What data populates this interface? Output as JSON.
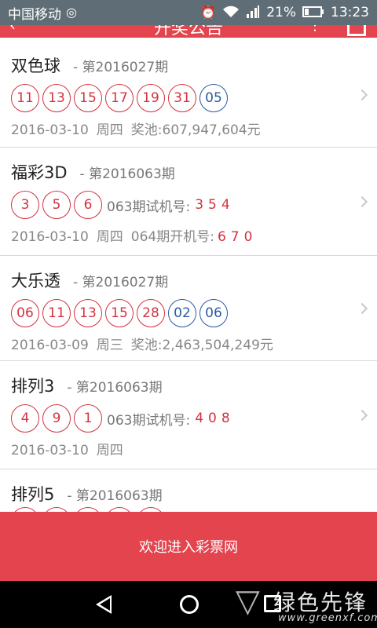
{
  "status_bar": {
    "carrier": "中国移动",
    "battery": "21%",
    "time": "13:23",
    "icons": [
      "hotspot-icon",
      "alarm-icon",
      "wifi-icon",
      "signal-icon",
      "battery-icon"
    ]
  },
  "header": {
    "title": "开奖公告",
    "icons": [
      "back-arrow-icon",
      "more-icon",
      "share-icon"
    ]
  },
  "lotteries": [
    {
      "name": "双色球",
      "issue": "- 第2016027期",
      "red_balls": [
        "11",
        "13",
        "15",
        "17",
        "19",
        "31"
      ],
      "blue_balls": [
        "05"
      ],
      "date": "2016-03-10",
      "weekday": "周四",
      "extra": "奖池:607,947,604元"
    },
    {
      "name": "福彩3D",
      "issue": "- 第2016063期",
      "red_balls": [
        "3",
        "5",
        "6"
      ],
      "trial_label": "063期试机号:",
      "trial_number": "354",
      "date": "2016-03-10",
      "weekday": "周四",
      "extra_label": "064期开机号:",
      "extra_number": "670"
    },
    {
      "name": "大乐透",
      "issue": "- 第2016027期",
      "red_balls": [
        "06",
        "11",
        "13",
        "15",
        "28"
      ],
      "blue_balls": [
        "02",
        "06"
      ],
      "date": "2016-03-09",
      "weekday": "周三",
      "extra": "奖池:2,463,504,249元"
    },
    {
      "name": "排列3",
      "issue": "- 第2016063期",
      "red_balls": [
        "4",
        "9",
        "1"
      ],
      "trial_label": "063期试机号:",
      "trial_number": "408",
      "date": "2016-03-10",
      "weekday": "周四"
    },
    {
      "name": "排列5",
      "issue": "- 第2016063期"
    }
  ],
  "banner": {
    "text": "欢迎进入彩票网"
  },
  "watermark": {
    "text": "绿色先锋",
    "url": "www.greenxf.com"
  },
  "colors": {
    "accent": "#e3444d",
    "red_ball": "#d3323e",
    "blue_ball": "#2b5aa3",
    "status_bar": "#5f6e76"
  }
}
